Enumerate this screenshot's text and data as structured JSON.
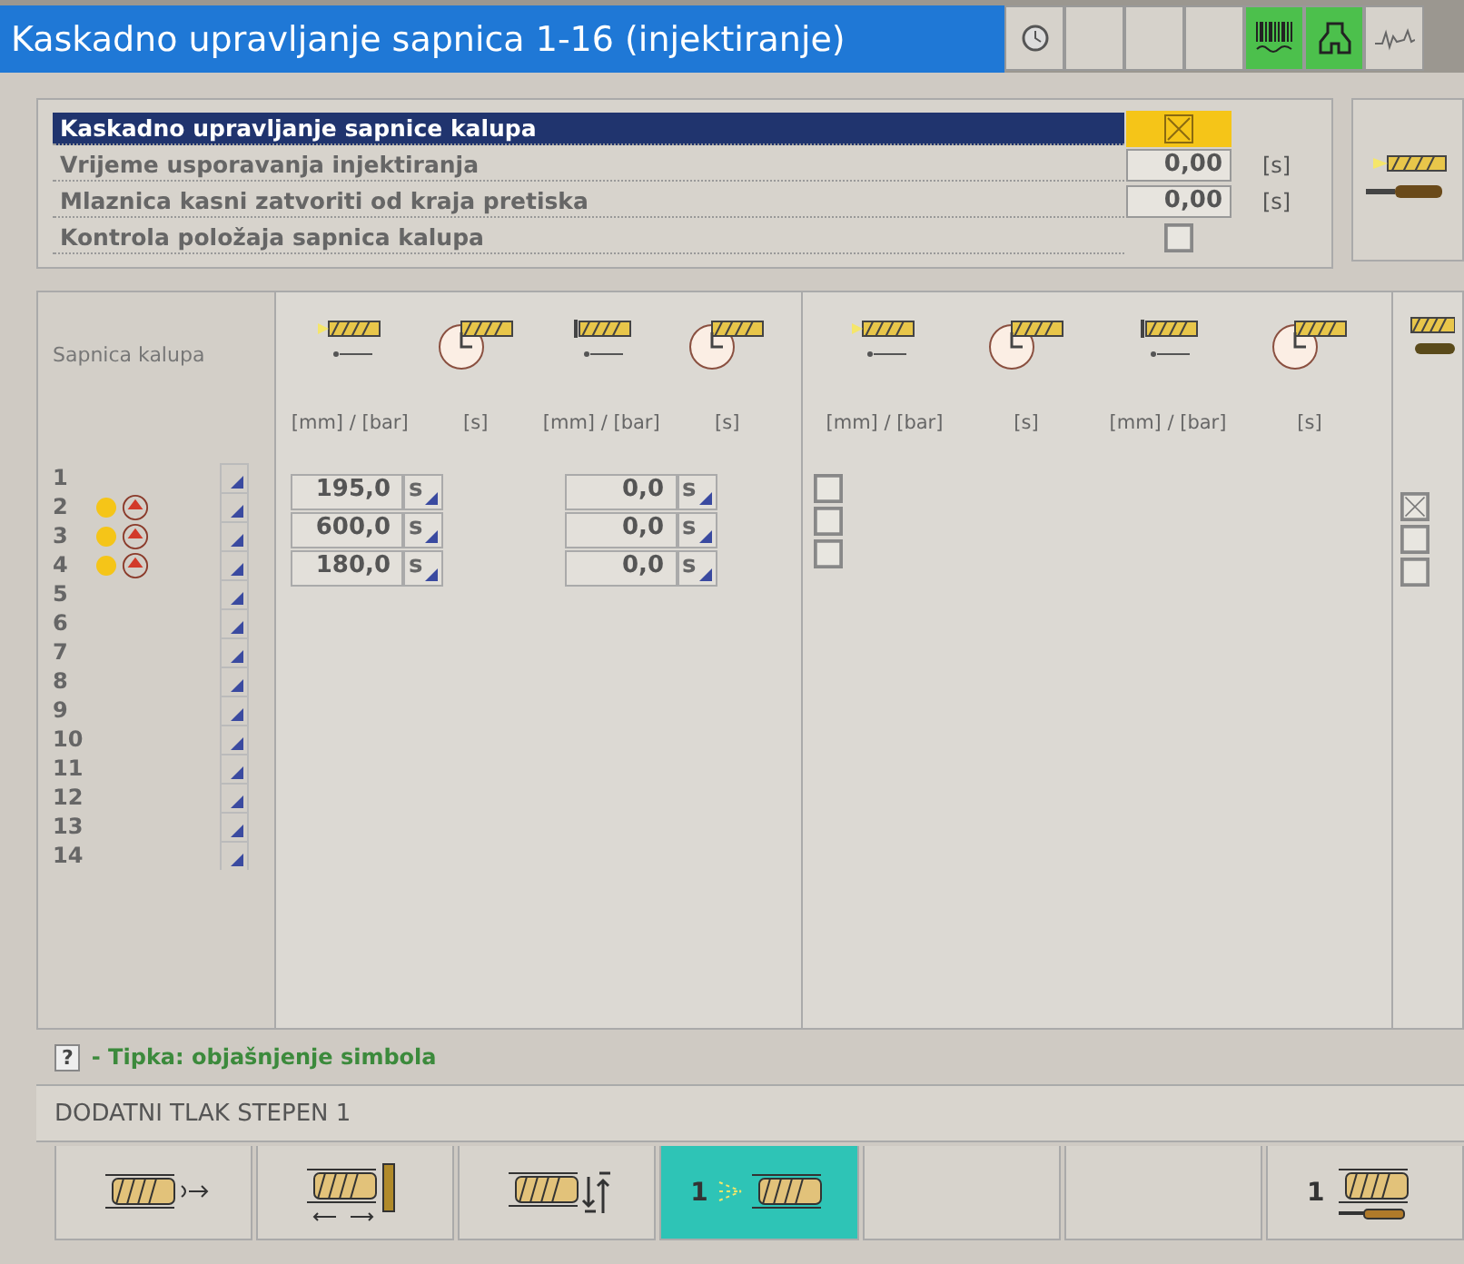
{
  "window": {
    "title": "Kaskadno upravljanje sapnica 1-16 (injektiranje)"
  },
  "header_buttons": [
    {
      "kind": "clock",
      "active": false
    },
    {
      "kind": "blank",
      "active": false
    },
    {
      "kind": "blank",
      "active": false
    },
    {
      "kind": "blank",
      "active": false
    },
    {
      "kind": "barcode",
      "active": true
    },
    {
      "kind": "mold",
      "active": true
    },
    {
      "kind": "wave",
      "active": false
    }
  ],
  "settings": [
    {
      "label": "Kaskadno upravljanje sapnice kalupa",
      "kind": "checkbox",
      "checked": true,
      "selected": true
    },
    {
      "label": "Vrijeme usporavanja injektiranja",
      "kind": "value",
      "value": "0,00",
      "unit": "[s]",
      "selected": false
    },
    {
      "label": "Mlaznica  kasni zatvoriti od kraja pretiska",
      "kind": "value",
      "value": "0,00",
      "unit": "[s]",
      "selected": false
    },
    {
      "label": "Kontrola položaja sapnica kalupa",
      "kind": "checkbox",
      "checked": false,
      "selected": false
    }
  ],
  "nozzles": {
    "heading": "Sapnica kalupa",
    "rows": [
      {
        "number": "1",
        "active": false
      },
      {
        "number": "2",
        "active": true
      },
      {
        "number": "3",
        "active": true
      },
      {
        "number": "4",
        "active": true
      },
      {
        "number": "5",
        "active": false
      },
      {
        "number": "6",
        "active": false
      },
      {
        "number": "7",
        "active": false
      },
      {
        "number": "8",
        "active": false
      },
      {
        "number": "9",
        "active": false
      },
      {
        "number": "10",
        "active": false
      },
      {
        "number": "11",
        "active": false
      },
      {
        "number": "12",
        "active": false
      },
      {
        "number": "13",
        "active": false
      },
      {
        "number": "14",
        "active": false
      }
    ]
  },
  "group_1": {
    "columns": [
      {
        "kind": "open",
        "unit": "[mm] / [bar]"
      },
      {
        "kind": "open_timer",
        "unit": "[s]"
      },
      {
        "kind": "close",
        "unit": "[mm] / [bar]"
      },
      {
        "kind": "close_timer",
        "unit": "[s]"
      }
    ],
    "rows": [
      {
        "open": "195,0",
        "open_mode": "s",
        "close": "0,0",
        "close_mode": "s"
      },
      {
        "open": "600,0",
        "open_mode": "s",
        "close": "0,0",
        "close_mode": "s"
      },
      {
        "open": "180,0",
        "open_mode": "s",
        "close": "0,0",
        "close_mode": "s"
      }
    ]
  },
  "group_2": {
    "columns": [
      {
        "kind": "open",
        "unit": "[mm] / [bar]"
      },
      {
        "kind": "open_timer",
        "unit": "[s]"
      },
      {
        "kind": "close",
        "unit": "[mm] / [bar]"
      },
      {
        "kind": "close_timer",
        "unit": "[s]"
      }
    ],
    "checkboxes": [
      {
        "checked": false
      },
      {
        "checked": false
      },
      {
        "checked": false
      }
    ]
  },
  "group_3": {
    "checkboxes": [
      {
        "checked": true
      },
      {
        "checked": false
      },
      {
        "checked": false
      }
    ]
  },
  "help": {
    "key": "?",
    "text": "- Tipka: objašnjenje simbola"
  },
  "status_bar": {
    "text": "DODATNI TLAK STEPEN 1"
  },
  "bottom_tabs": [
    {
      "kind": "dosing",
      "selected": false
    },
    {
      "kind": "injection",
      "selected": false
    },
    {
      "kind": "nozzle_move",
      "selected": false
    },
    {
      "kind": "hold",
      "label": "1",
      "selected": true
    },
    {
      "kind": "blank",
      "selected": false
    },
    {
      "kind": "blank",
      "selected": false
    },
    {
      "kind": "setup",
      "label": "1",
      "selected": false
    }
  ]
}
